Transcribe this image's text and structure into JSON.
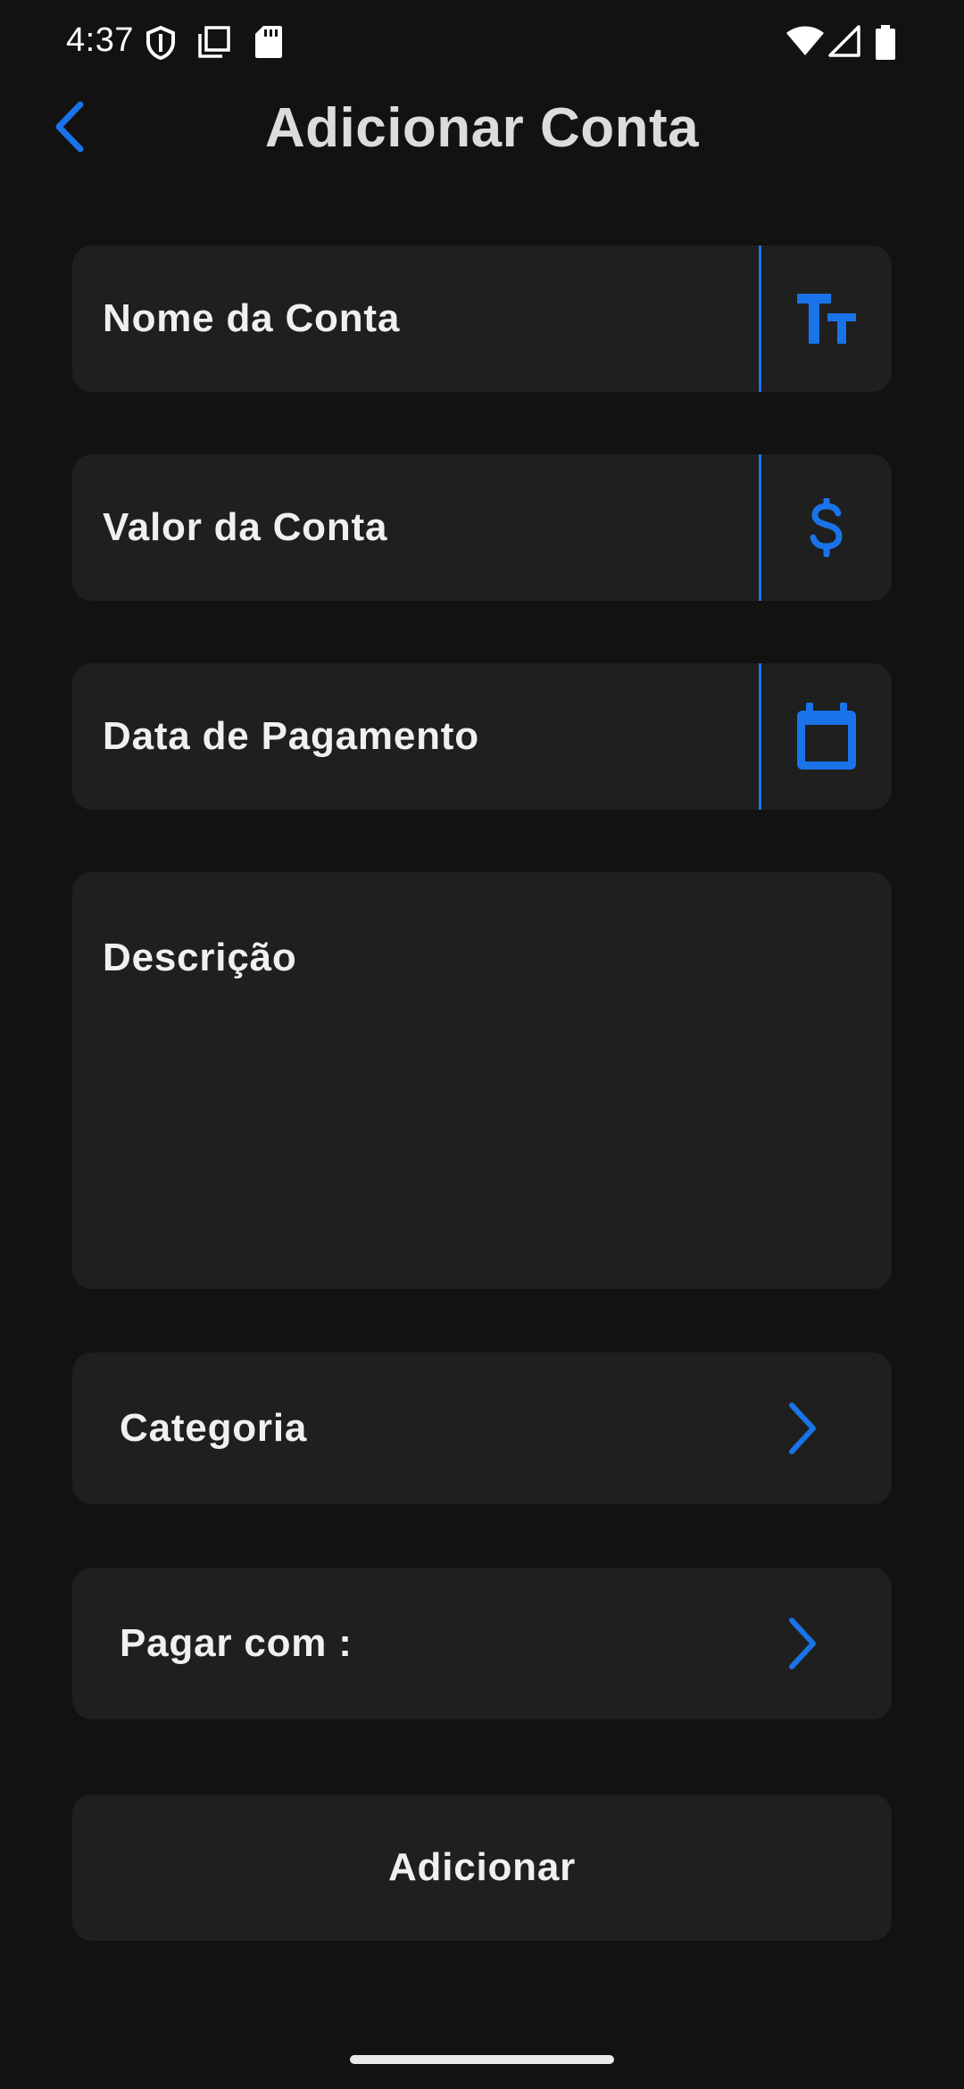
{
  "status_bar": {
    "time": "4:37",
    "icons": [
      "shield-icon",
      "copy-icon",
      "sd-card-icon",
      "wifi-icon",
      "signal-icon",
      "battery-icon"
    ]
  },
  "header": {
    "title": "Adicionar Conta",
    "back_icon": "chevron-left-icon"
  },
  "form": {
    "account_name": {
      "label": "Nome da Conta",
      "icon": "text-size-icon"
    },
    "account_value": {
      "label": "Valor da Conta",
      "icon": "dollar-icon"
    },
    "payment_date": {
      "label": "Data de Pagamento",
      "icon": "calendar-icon"
    },
    "description": {
      "label": "Descrição"
    },
    "category": {
      "label": "Categoria",
      "icon": "chevron-right-icon"
    },
    "pay_with": {
      "label": "Pagar com :",
      "icon": "chevron-right-icon"
    },
    "submit_label": "Adicionar"
  },
  "colors": {
    "background": "#121212",
    "field": "#1f1f1f",
    "accent": "#1a73e8",
    "text": "#f0f0f0",
    "title": "#dcdcdc"
  }
}
